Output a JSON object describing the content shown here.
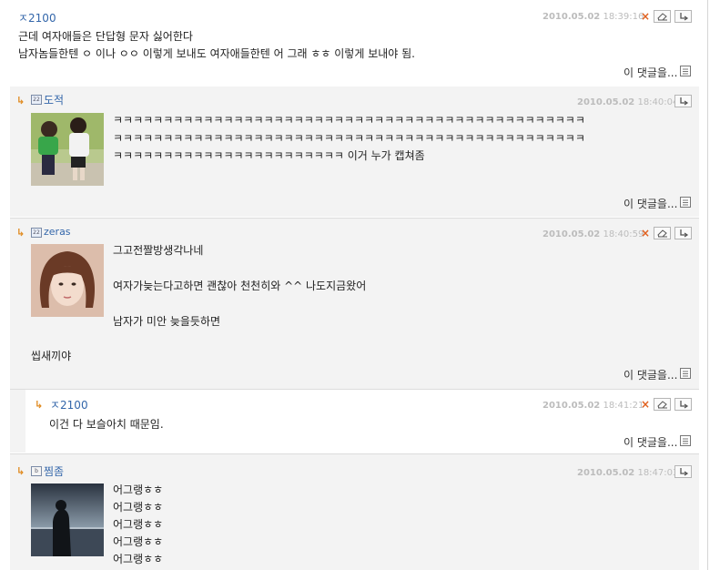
{
  "more_label": "이 댓글을...",
  "comments": [
    {
      "author": "ㅈ2100",
      "date": "2010.05.02",
      "time": "18:39:16",
      "lines": [
        "근데 여자애들은 단답형 문자 싫어한다",
        "남자놈들한텐 ㅇ 이나 ㅇㅇ 이렇게 보내도 여자애들한텐 어 그래 ㅎㅎ 이렇게 보내야 됨."
      ]
    },
    {
      "author": "도적",
      "date": "2010.05.02",
      "time": "18:40:04",
      "lines": [
        "ㅋㅋㅋㅋㅋㅋㅋㅋㅋㅋㅋㅋㅋㅋㅋㅋㅋㅋㅋㅋㅋㅋㅋㅋㅋㅋㅋㅋㅋㅋㅋㅋㅋㅋㅋㅋㅋㅋㅋㅋㅋㅋㅋㅋㅋㅋㅋ",
        "ㅋㅋㅋㅋㅋㅋㅋㅋㅋㅋㅋㅋㅋㅋㅋㅋㅋㅋㅋㅋㅋㅋㅋㅋㅋㅋㅋㅋㅋㅋㅋㅋㅋㅋㅋㅋㅋㅋㅋㅋㅋㅋㅋㅋㅋㅋㅋ",
        "ㅋㅋㅋㅋㅋㅋㅋㅋㅋㅋㅋㅋㅋㅋㅋㅋㅋㅋㅋㅋㅋㅋㅋ 이거 누가 캡쳐좀"
      ]
    },
    {
      "author": "zeras",
      "date": "2010.05.02",
      "time": "18:40:59",
      "lines": [
        "그고전짤방생각나네",
        "여자가늦는다고하면 괜찮아 천천히와 ^^ 나도지금왔어",
        "남자가 미안 늦을듯하면"
      ],
      "tail": "씹새끼야"
    },
    {
      "author": "ㅈ2100",
      "date": "2010.05.02",
      "time": "18:41:21",
      "lines": [
        "이건 다 보슬아치 때문임."
      ]
    },
    {
      "author": "찜좀",
      "date": "2010.05.02",
      "time": "18:47:03",
      "lines": [
        "어그랭ㅎㅎ",
        "어그랭ㅎㅎ",
        "어그랭ㅎㅎ",
        "어그랭ㅎㅎ",
        "어그랭ㅎㅎ"
      ]
    }
  ]
}
